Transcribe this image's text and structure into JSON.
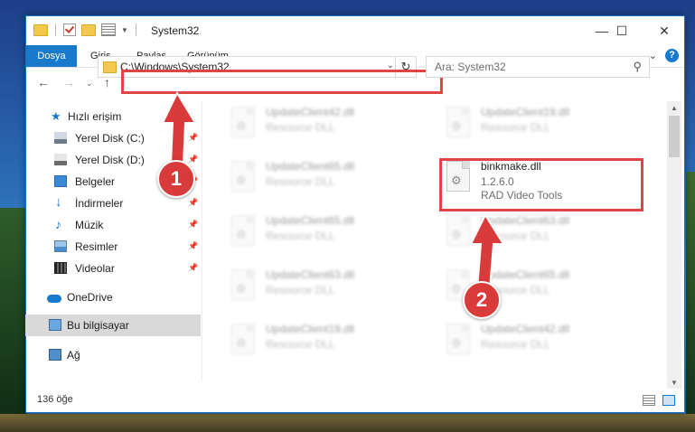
{
  "window": {
    "title": "System32"
  },
  "ribbon": {
    "tabs": [
      "Dosya",
      "Giriş",
      "Paylaş",
      "Görünüm"
    ],
    "help_label": "?"
  },
  "address": {
    "path": "C:\\Windows\\System32"
  },
  "search": {
    "placeholder": "Ara: System32"
  },
  "sidebar": {
    "items": [
      {
        "label": "Hızlı erişim",
        "icon": "star-icon"
      },
      {
        "label": "Yerel Disk (C:)",
        "icon": "drive-icon"
      },
      {
        "label": "Yerel Disk (D:)",
        "icon": "drive-icon"
      },
      {
        "label": "Belgeler",
        "icon": "documents-icon"
      },
      {
        "label": "İndirmeler",
        "icon": "download-arrow-icon"
      },
      {
        "label": "Müzik",
        "icon": "music-note-icon"
      },
      {
        "label": "Resimler",
        "icon": "pictures-icon"
      },
      {
        "label": "Videolar",
        "icon": "film-icon"
      },
      {
        "label": "OneDrive",
        "icon": "cloud-icon"
      },
      {
        "label": "Bu bilgisayar",
        "icon": "computer-icon"
      },
      {
        "label": "Ağ",
        "icon": "network-icon"
      }
    ]
  },
  "files": [
    {
      "name": "UpdateClient42.dll",
      "line2": "Resource DLL",
      "line3": "",
      "blurred": true
    },
    {
      "name": "UpdateClient19.dll",
      "line2": "Resource DLL",
      "line3": "",
      "blurred": true
    },
    {
      "name": "UpdateClient65.dll",
      "line2": "Resource DLL",
      "line3": "",
      "blurred": true
    },
    {
      "name": "binkmake.dll",
      "line2": "1.2.6.0",
      "line3": "RAD Video Tools",
      "blurred": false
    },
    {
      "name": "UpdateClient65.dll",
      "line2": "Resource DLL",
      "line3": "",
      "blurred": true
    },
    {
      "name": "UpdateClient63.dll",
      "line2": "Resource DLL",
      "line3": "",
      "blurred": true
    },
    {
      "name": "UpdateClient63.dll",
      "line2": "Resource DLL",
      "line3": "",
      "blurred": true
    },
    {
      "name": "UpdateClient65.dll",
      "line2": "Resource DLL",
      "line3": "",
      "blurred": true
    },
    {
      "name": "UpdateClient19.dll",
      "line2": "Resource DLL",
      "line3": "",
      "blurred": true
    },
    {
      "name": "UpdateClient42.dll",
      "line2": "Resource DLL",
      "line3": "",
      "blurred": true
    }
  ],
  "status": {
    "count": "136 öğe"
  },
  "annotations": {
    "step1": "1",
    "step2": "2",
    "color": "#d93a3a"
  }
}
